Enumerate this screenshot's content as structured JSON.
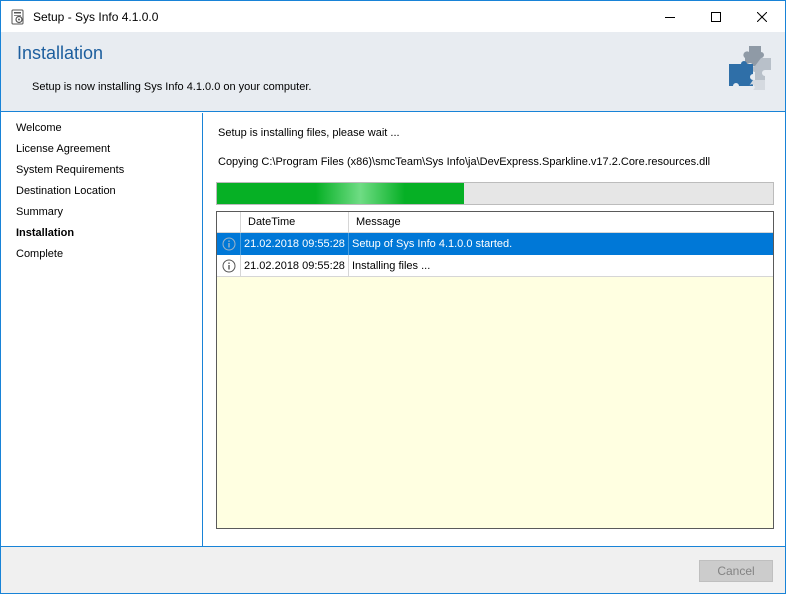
{
  "window": {
    "title": "Setup - Sys Info 4.1.0.0"
  },
  "header": {
    "title": "Installation",
    "subtitle": "Setup is now installing Sys Info 4.1.0.0 on your computer.",
    "icon": "puzzle-icon"
  },
  "sidebar": {
    "items": [
      {
        "label": "Welcome",
        "active": false
      },
      {
        "label": "License Agreement",
        "active": false
      },
      {
        "label": "System Requirements",
        "active": false
      },
      {
        "label": "Destination Location",
        "active": false
      },
      {
        "label": "Summary",
        "active": false
      },
      {
        "label": "Installation",
        "active": true
      },
      {
        "label": "Complete",
        "active": false
      }
    ]
  },
  "main": {
    "status": "Setup is installing files, please wait ...",
    "copying": "Copying C:\\Program Files (x86)\\smcTeam\\Sys Info\\ja\\DevExpress.Sparkline.v17.2.Core.resources.dll",
    "progress_percent": 44.5,
    "log": {
      "columns": [
        "",
        "DateTime",
        "Message"
      ],
      "rows": [
        {
          "icon": "info-icon",
          "datetime": "21.02.2018 09:55:28",
          "message": "Setup of Sys Info 4.1.0.0 started.",
          "selected": true
        },
        {
          "icon": "info-icon",
          "datetime": "21.02.2018 09:55:28",
          "message": "Installing files ...",
          "selected": false
        }
      ]
    }
  },
  "footer": {
    "cancel_label": "Cancel"
  },
  "colors": {
    "accent": "#1883d7",
    "header_title": "#1c5e9e",
    "progress": "#06b025",
    "selection": "#0078d7",
    "log_background": "#ffffe1"
  }
}
